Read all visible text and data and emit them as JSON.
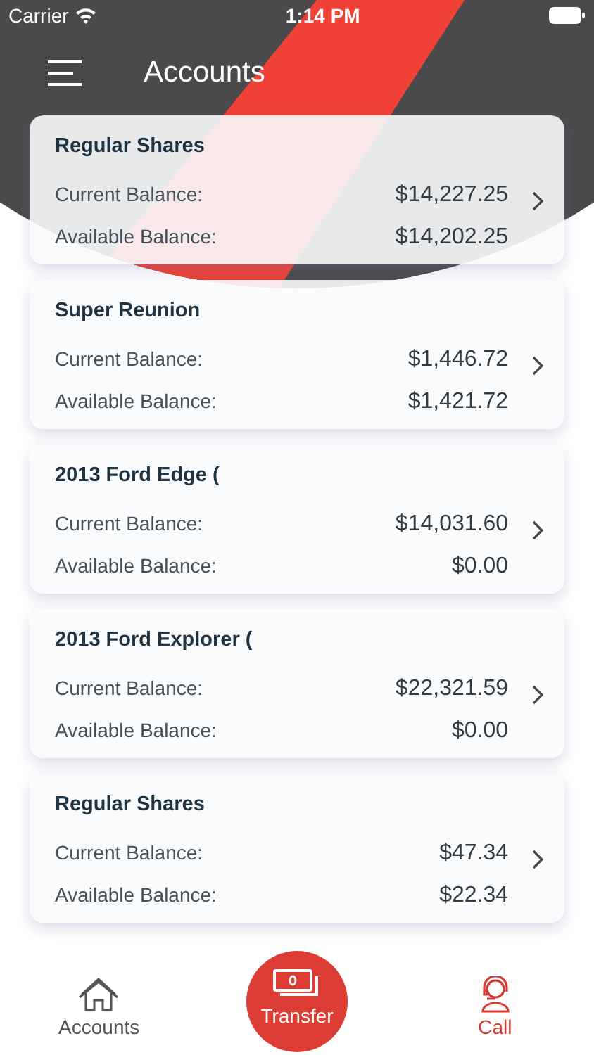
{
  "status_bar": {
    "carrier": "Carrier",
    "time": "1:14 PM"
  },
  "header": {
    "title": "Accounts"
  },
  "accounts": [
    {
      "name": "Regular Shares",
      "current_label": "Current Balance:",
      "current": "$14,227.25",
      "available_label": "Available Balance:",
      "available": "$14,202.25"
    },
    {
      "name": "Super Reunion",
      "current_label": "Current Balance:",
      "current": "$1,446.72",
      "available_label": "Available Balance:",
      "available": "$1,421.72"
    },
    {
      "name": "2013 Ford Edge (",
      "current_label": "Current Balance:",
      "current": "$14,031.60",
      "available_label": "Available Balance:",
      "available": "$0.00"
    },
    {
      "name": "2013 Ford Explorer (",
      "current_label": "Current Balance:",
      "current": "$22,321.59",
      "available_label": "Available Balance:",
      "available": "$0.00"
    },
    {
      "name": "Regular Shares",
      "current_label": "Current Balance:",
      "current": "$47.34",
      "available_label": "Available Balance:",
      "available": "$22.34"
    }
  ],
  "tab_bar": [
    {
      "label": "Accounts",
      "kind": "home"
    },
    {
      "label": "Transfer",
      "kind": "transfer"
    },
    {
      "label": "Call",
      "kind": "call"
    }
  ]
}
